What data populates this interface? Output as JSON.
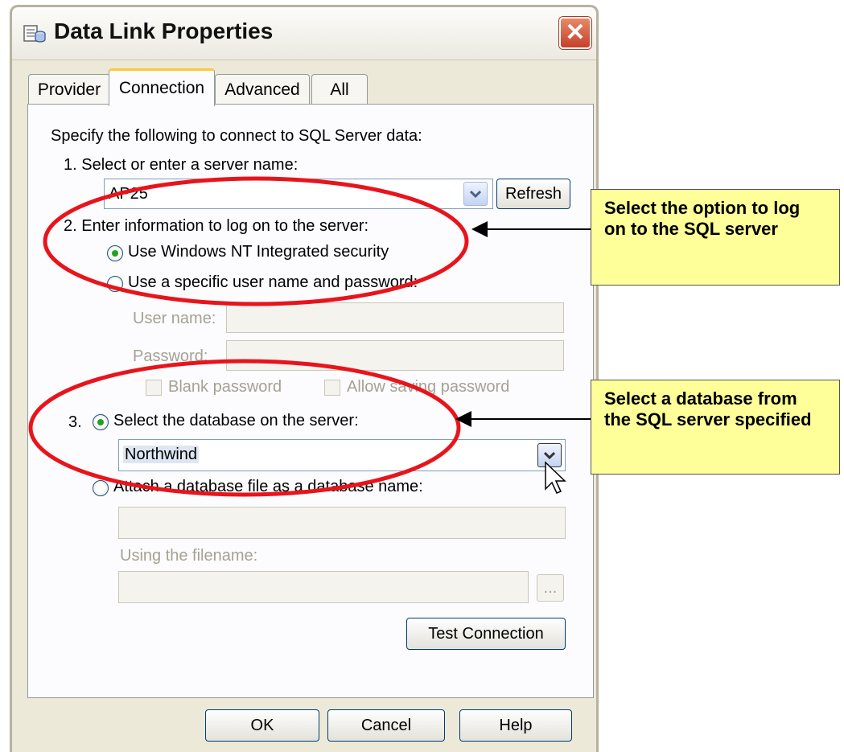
{
  "window": {
    "title": "Data Link Properties"
  },
  "tabs": [
    {
      "label": "Provider"
    },
    {
      "label": "Connection"
    },
    {
      "label": "Advanced"
    },
    {
      "label": "All"
    }
  ],
  "connection": {
    "intro": "Specify the following to connect to SQL Server data:",
    "step1": {
      "label": "1. Select or enter a server name:",
      "server_value": "AP25",
      "refresh_label": "Refresh"
    },
    "step2": {
      "label": "2. Enter information to log on to the server:",
      "option_integrated": "Use Windows NT Integrated security",
      "option_specific": "Use a specific user name and password:",
      "selected": "integrated",
      "username_label": "User name:",
      "username_value": "",
      "password_label": "Password:",
      "password_value": "",
      "blank_password_label": "Blank password",
      "allow_saving_label": "Allow saving password"
    },
    "step3": {
      "number": "3.",
      "option_select_db": "Select the database on the server:",
      "database_value": "Northwind",
      "option_attach": "Attach a database file as a database name:",
      "attach_value": "",
      "filename_label": "Using the filename:",
      "filename_value": "",
      "browse_label": "..."
    },
    "test_connection_label": "Test Connection"
  },
  "footer": {
    "ok_label": "OK",
    "cancel_label": "Cancel",
    "help_label": "Help"
  },
  "annotations": {
    "callout1": "Select the option to log on to the SQL server",
    "callout2": "Select a database from the SQL server specified"
  },
  "colors": {
    "callout_fill": "#ffff99",
    "highlight_ellipse": "#e8141c",
    "tab_accent": "#ffc83c",
    "radio_dot": "#21a121"
  }
}
